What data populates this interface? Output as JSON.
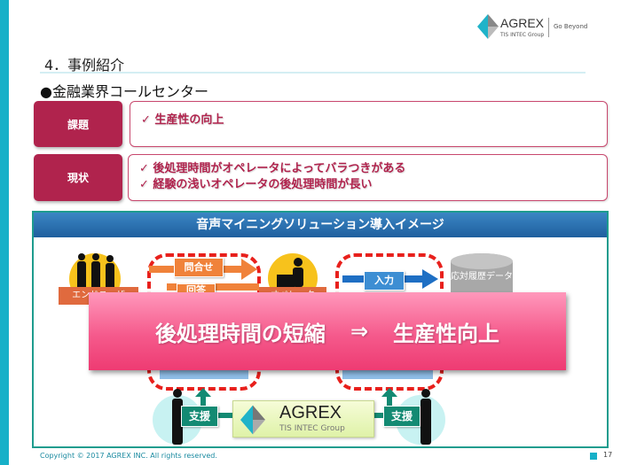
{
  "logo": {
    "name": "AGREX",
    "group": "TIS INTEC Group",
    "tagline": "Go Beyond"
  },
  "title": "4．事例紹介",
  "subheading": "●金融業界コールセンター",
  "issue": {
    "label": "課題",
    "items": [
      "✓  生産性の向上"
    ]
  },
  "current": {
    "label": "現状",
    "items": [
      "✓  後処理時間がオペレータによってバラつきがある",
      "✓  経験の浅いオペレータの後処理時間が長い"
    ]
  },
  "diagram": {
    "title": "音声マイニングソリューション導入イメージ",
    "end_user_label": "エンドユーザ",
    "inquiry_label": "問合せ",
    "answer_label": "回答",
    "operator_label": "オペレータ",
    "input_label": "入力",
    "db_label": "応対履歴データ",
    "support_left": "支援",
    "support_right": "支援",
    "agrex_name": "AGREX",
    "agrex_group": "TIS INTEC Group"
  },
  "overlay": {
    "left": "後処理時間の短縮",
    "arrow": "⇒",
    "right": "生産性向上"
  },
  "footer": {
    "copyright": "Copyright © 2017 AGREX INC. All rights reserved.",
    "page": "17"
  },
  "colors": {
    "accent": "#17b0c8",
    "label": "#b0234d",
    "overlay": "#f55a8c",
    "header": "#2a70b0"
  }
}
